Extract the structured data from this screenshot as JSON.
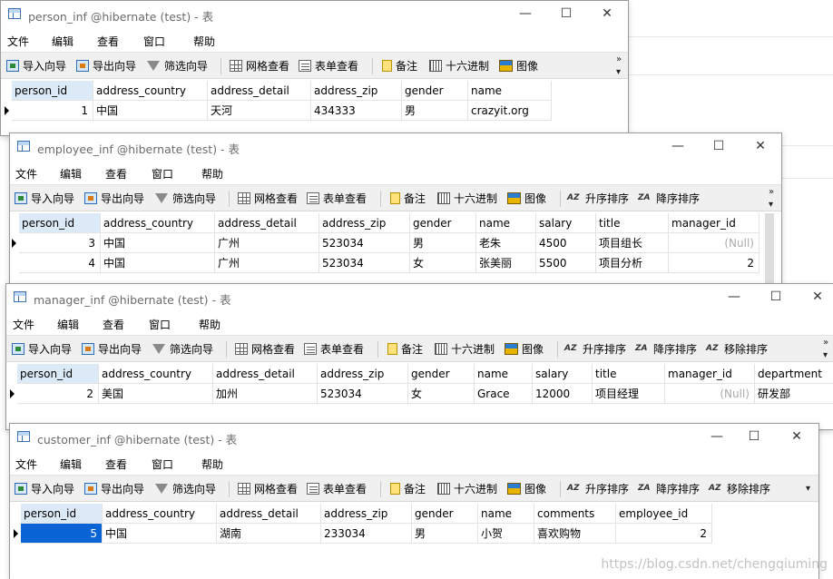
{
  "toolbar_labels": {
    "import": "导入向导",
    "export": "导出向导",
    "filter": "筛选向导",
    "grid_view": "网格查看",
    "form_view": "表单查看",
    "memo": "备注",
    "hex": "十六进制",
    "image": "图像",
    "sort_asc": "升序排序",
    "sort_desc": "降序排序",
    "remove_sort": "移除排序"
  },
  "menu_labels": [
    "文件",
    "编辑",
    "查看",
    "窗口",
    "帮助"
  ],
  "window_buttons": {
    "minimize": "—",
    "maximize": "☐",
    "close": "✕"
  },
  "null_text": "(Null)",
  "watermark": "https://blog.csdn.net/chengqiuming",
  "windows": [
    {
      "title": "person_inf @hibernate (test) - 表",
      "columns": [
        "person_id",
        "address_country",
        "address_detail",
        "address_zip",
        "gender",
        "name"
      ],
      "rows": [
        [
          "1",
          "中国",
          "天河",
          "434333",
          "男",
          "crazyit.org"
        ]
      ]
    },
    {
      "title": "employee_inf @hibernate (test) - 表",
      "columns": [
        "person_id",
        "address_country",
        "address_detail",
        "address_zip",
        "gender",
        "name",
        "salary",
        "title",
        "manager_id"
      ],
      "rows": [
        [
          "3",
          "中国",
          "广州",
          "523034",
          "男",
          "老朱",
          "4500",
          "项目组长",
          "(Null)"
        ],
        [
          "4",
          "中国",
          "广州",
          "523034",
          "女",
          "张美丽",
          "5500",
          "项目分析",
          "2"
        ]
      ]
    },
    {
      "title": "manager_inf @hibernate (test) - 表",
      "columns": [
        "person_id",
        "address_country",
        "address_detail",
        "address_zip",
        "gender",
        "name",
        "salary",
        "title",
        "manager_id",
        "department"
      ],
      "rows": [
        [
          "2",
          "美国",
          "加州",
          "523034",
          "女",
          "Grace",
          "12000",
          "项目经理",
          "(Null)",
          "研发部"
        ]
      ]
    },
    {
      "title": "customer_inf @hibernate (test) - 表",
      "columns": [
        "person_id",
        "address_country",
        "address_detail",
        "address_zip",
        "gender",
        "name",
        "comments",
        "employee_id"
      ],
      "rows": [
        [
          "5",
          "中国",
          "湖南",
          "233034",
          "男",
          "小贺",
          "喜欢购物",
          "2"
        ]
      ]
    }
  ]
}
